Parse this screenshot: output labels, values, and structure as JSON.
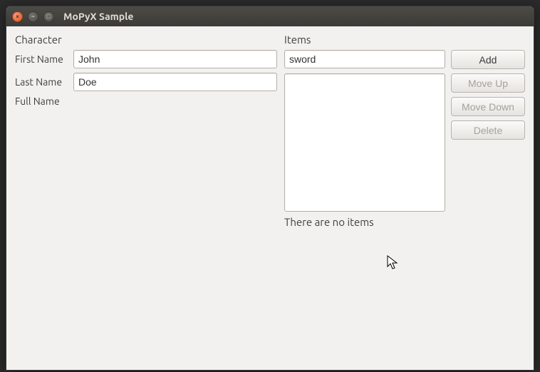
{
  "window": {
    "title": "MoPyX Sample"
  },
  "character": {
    "heading": "Character",
    "first_name_label": "First Name",
    "first_name_value": "John",
    "last_name_label": "Last Name",
    "last_name_value": "Doe",
    "full_name_label": "Full Name",
    "full_name_value": ""
  },
  "items": {
    "heading": "Items",
    "new_item_value": "sword",
    "list": [],
    "status": "There are no items",
    "buttons": {
      "add": "Add",
      "move_up": "Move Up",
      "move_down": "Move Down",
      "delete": "Delete"
    }
  }
}
